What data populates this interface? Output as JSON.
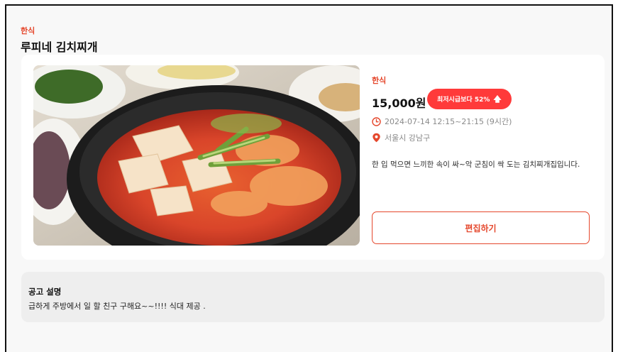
{
  "header": {
    "category": "한식",
    "title": "루피네 김치찌개"
  },
  "post": {
    "category": "한식",
    "price": "15,000원",
    "badge": "최저시급보다 52%",
    "badge_icon": "arrow-up-icon",
    "time_icon": "clock-icon",
    "time": "2024-07-14 12:15~21:15 (9시간)",
    "location_icon": "location-pin-icon",
    "location": "서울시 강남구",
    "description": "한 입 먹으면 느끼한 속이 싸~악 군침이 싹 도는 김치찌개집입니다.",
    "edit_label": "편집하기"
  },
  "notice": {
    "title": "공고 설명",
    "body": "급하게 주방에서 일 할 친구 구해요~~!!!! 식대 제공 ."
  },
  "colors": {
    "accent": "#e5472c",
    "badge": "#ff3a3a",
    "background": "#f8f8f8",
    "card": "#ffffff",
    "notice_bg": "#eeeeee"
  }
}
